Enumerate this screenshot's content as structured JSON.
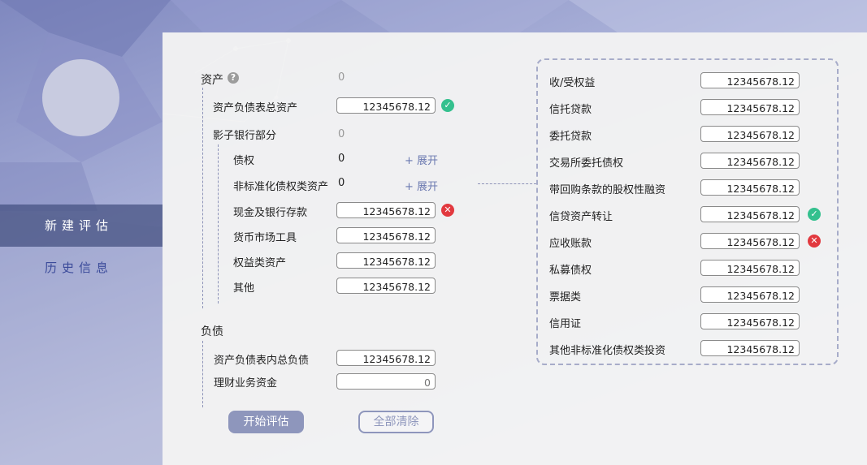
{
  "sidebar": {
    "items": [
      {
        "label": "新建评估",
        "active": true
      },
      {
        "label": "历史信息",
        "active": false
      }
    ]
  },
  "assets": {
    "title": "资产",
    "help_icon": "question-circle-icon",
    "total": "0",
    "balance_total": {
      "label": "资产负债表总资产",
      "value": "12345678.12",
      "status": "valid"
    },
    "shadow": {
      "label": "影子银行部分",
      "total": "0",
      "debt": {
        "label": "债权",
        "value": "0",
        "expand": "+ 展开"
      },
      "nonstd": {
        "label": "非标准化债权类资产",
        "value": "0",
        "expand": "+ 展开"
      },
      "cash": {
        "label": "现金及银行存款",
        "value": "12345678.12",
        "status": "invalid"
      },
      "money_market": {
        "label": "货币市场工具",
        "value": "12345678.12"
      },
      "equity": {
        "label": "权益类资产",
        "value": "12345678.12"
      },
      "other": {
        "label": "其他",
        "value": "12345678.12"
      }
    }
  },
  "liabilities": {
    "title": "负债",
    "balance_total": {
      "label": "资产负债表内总负债",
      "value": "12345678.12"
    },
    "wealth_funds": {
      "label": "理财业务资金",
      "placeholder": "0"
    }
  },
  "nonstd_detail": [
    {
      "label": "收/受权益",
      "value": "12345678.12",
      "status": ""
    },
    {
      "label": "信托贷款",
      "value": "12345678.12",
      "status": ""
    },
    {
      "label": "委托贷款",
      "value": "12345678.12",
      "status": ""
    },
    {
      "label": "交易所委托债权",
      "value": "12345678.12",
      "status": ""
    },
    {
      "label": "带回购条款的股权性融资",
      "value": "12345678.12",
      "status": ""
    },
    {
      "label": "信贷资产转让",
      "value": "12345678.12",
      "status": "valid"
    },
    {
      "label": "应收账款",
      "value": "12345678.12",
      "status": "invalid"
    },
    {
      "label": "私募债权",
      "value": "12345678.12",
      "status": ""
    },
    {
      "label": "票据类",
      "value": "12345678.12",
      "status": ""
    },
    {
      "label": "信用证",
      "value": "12345678.12",
      "status": ""
    },
    {
      "label": "其他非标准化债权类投资",
      "value": "12345678.12",
      "status": ""
    }
  ],
  "actions": {
    "start": "开始评估",
    "clear": "全部清除"
  },
  "status_icons": {
    "valid": "check-circle-icon",
    "invalid": "x-circle-icon"
  },
  "colors": {
    "nav_active_bg": "#465282",
    "nav_text": "#3b4b9a",
    "valid": "#34c08e",
    "invalid": "#e2393f",
    "button": "#8e96bc",
    "link": "#6a78b0"
  }
}
